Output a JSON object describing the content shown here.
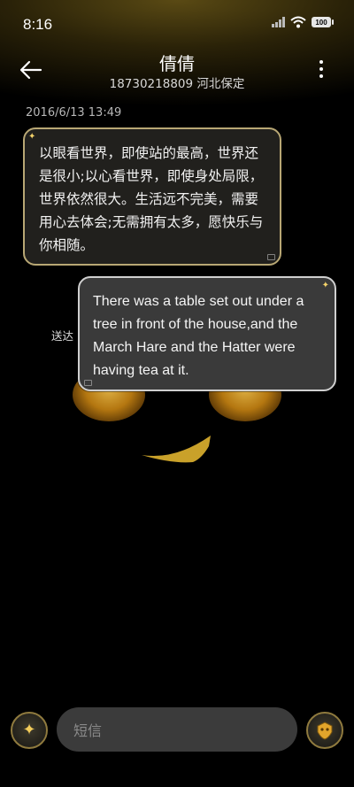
{
  "status_bar": {
    "time": "8:16",
    "battery": "100",
    "icons": [
      "signal-icon",
      "wifi-icon",
      "battery-icon"
    ]
  },
  "header": {
    "contact_name": "倩倩",
    "contact_sub": "18730218809 河北保定",
    "back_icon": "back-arrow-icon",
    "more_icon": "more-vertical-icon"
  },
  "conversation": {
    "timestamp": "2016/6/13 13:49",
    "messages": [
      {
        "direction": "incoming",
        "text": "以眼看世界，即使站的最高，世界还是很小;以心看世界，即使身处局限，世界依然很大。生活远不完美，需要用心去体会;无需拥有太多，愿快乐与你相随。"
      },
      {
        "direction": "outgoing",
        "text": "There was a table set out under a tree in front of the house,and the March Hare and the Hatter were having tea at it."
      }
    ],
    "partial_label": "送达"
  },
  "composer": {
    "placeholder": "短信",
    "left_button_icon": "sparkle-icon",
    "right_button_icon": "gold-theme-icon"
  },
  "colors": {
    "bubble_border_incoming": "#b8a774",
    "bubble_border_outgoing": "#cfcfcf",
    "accent_gold": "#f3cc5a",
    "input_bg": "#3b3b3b"
  }
}
